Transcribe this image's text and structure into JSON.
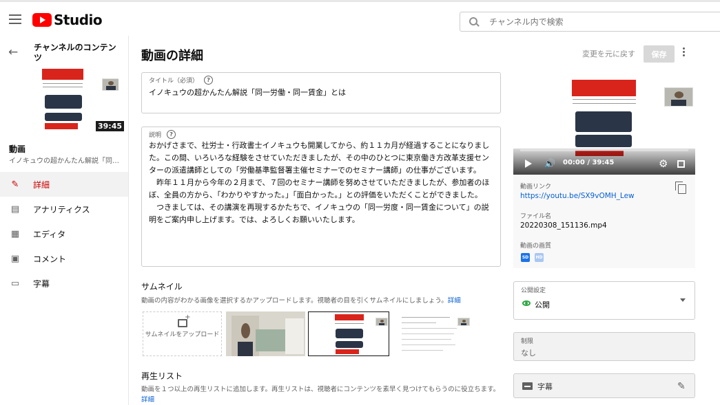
{
  "header": {
    "logo_text": "Studio",
    "search_placeholder": "チャンネル内で検索"
  },
  "sidebar": {
    "channel_title": "チャンネルのコンテンツ",
    "duration": "39:45",
    "video_heading": "動画",
    "video_subtitle": "イノキュウの超かんたん解説「同一...",
    "items": [
      {
        "label": "詳細",
        "icon": "pencil-icon",
        "active": true
      },
      {
        "label": "アナリティクス",
        "icon": "analytics-icon",
        "active": false
      },
      {
        "label": "エディタ",
        "icon": "editor-icon",
        "active": false
      },
      {
        "label": "コメント",
        "icon": "comment-icon",
        "active": false
      },
      {
        "label": "字幕",
        "icon": "subtitles-icon",
        "active": false
      }
    ]
  },
  "main": {
    "page_title": "動画の詳細",
    "undo_label": "変更を元に戻す",
    "save_label": "保存",
    "title_field": {
      "label": "タイトル（必須）",
      "value": "イノキュウの超かんたん解説「同一労働・同一賃金」とは"
    },
    "description_field": {
      "label": "説明",
      "value": "おかげさまで、社労士・行政書士イノキュウも開業してから、約１１カ月が経過することになりました。この間、いろいろな経験をさせていただきましたが、その中のひとつに東京働き方改革支援センターの派遣講師としての「労働基準監督署主催セミナーでのセミナー講師」の仕事がございます。\n　昨年１１月から今年の２月まで、７回のセミナー講師を努めさせていただきましたが、参加者のほぼ、全員の方から、「わかりやすかった。」「面白かった。」との評価をいただくことができました。\n　つきましては、その講演を再現するかたちで、イノキュウの「同一労度・同一賃金について」の説明をご案内申し上げます。では、よろしくお願いいたします。"
    },
    "thumbnail": {
      "title": "サムネイル",
      "note": "動画の内容がわかる画像を選択するかアップロードします。視聴者の目を引くサムネイルにしましょう。",
      "link": "詳細",
      "upload_label": "サムネイルをアップロード"
    },
    "playlist": {
      "title": "再生リスト",
      "note": "動画を１つ以上の再生リストに追加します。再生リストは、視聴者にコンテンツを素早く見つけてもらうのに役立ちます。",
      "link": "詳細"
    }
  },
  "video_panel": {
    "time": "00:00 / 39:45",
    "link_label": "動画リンク",
    "link_value": "https://youtu.be/SX9vOMH_Lew",
    "filename_label": "ファイル名",
    "filename_value": "20220308_151136.mp4",
    "quality_label": "動画の画質",
    "quality_badges": [
      "SD",
      "HD"
    ],
    "colors": {
      "sd": "#1a73e8",
      "hd": "#a9c7f2"
    }
  },
  "visibility": {
    "label": "公開設定",
    "value": "公開"
  },
  "restriction": {
    "label": "制限",
    "value": "なし"
  },
  "subtitles": {
    "label": "字幕"
  },
  "colors": {
    "accent_red": "#cc0000",
    "link_blue": "#065fd4",
    "public_green": "#2ba640"
  }
}
